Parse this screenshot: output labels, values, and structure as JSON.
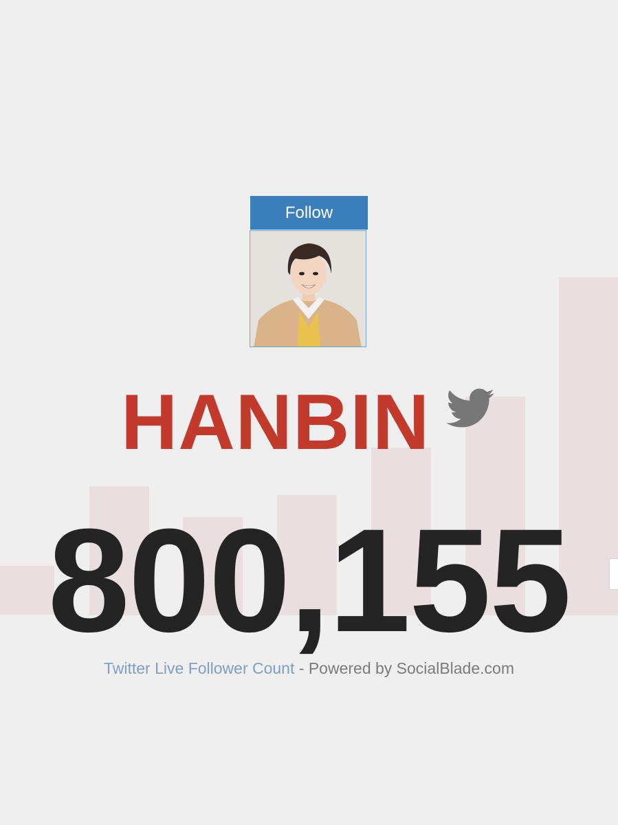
{
  "follow_button": {
    "label": "Follow"
  },
  "channel": {
    "name": "HANBIN",
    "platform_icon": "twitter-bird-icon"
  },
  "stats": {
    "follower_count": "800,155"
  },
  "footer": {
    "link_text": "Twitter Live Follower Count",
    "separator": " - ",
    "powered_by": "Powered by SocialBlade.com"
  },
  "colors": {
    "name": "#c23a2b",
    "follow_button": "#3a7fbb",
    "count": "#242424",
    "footer_link": "#7e9ec2",
    "background_bars": "#eadfe0"
  }
}
